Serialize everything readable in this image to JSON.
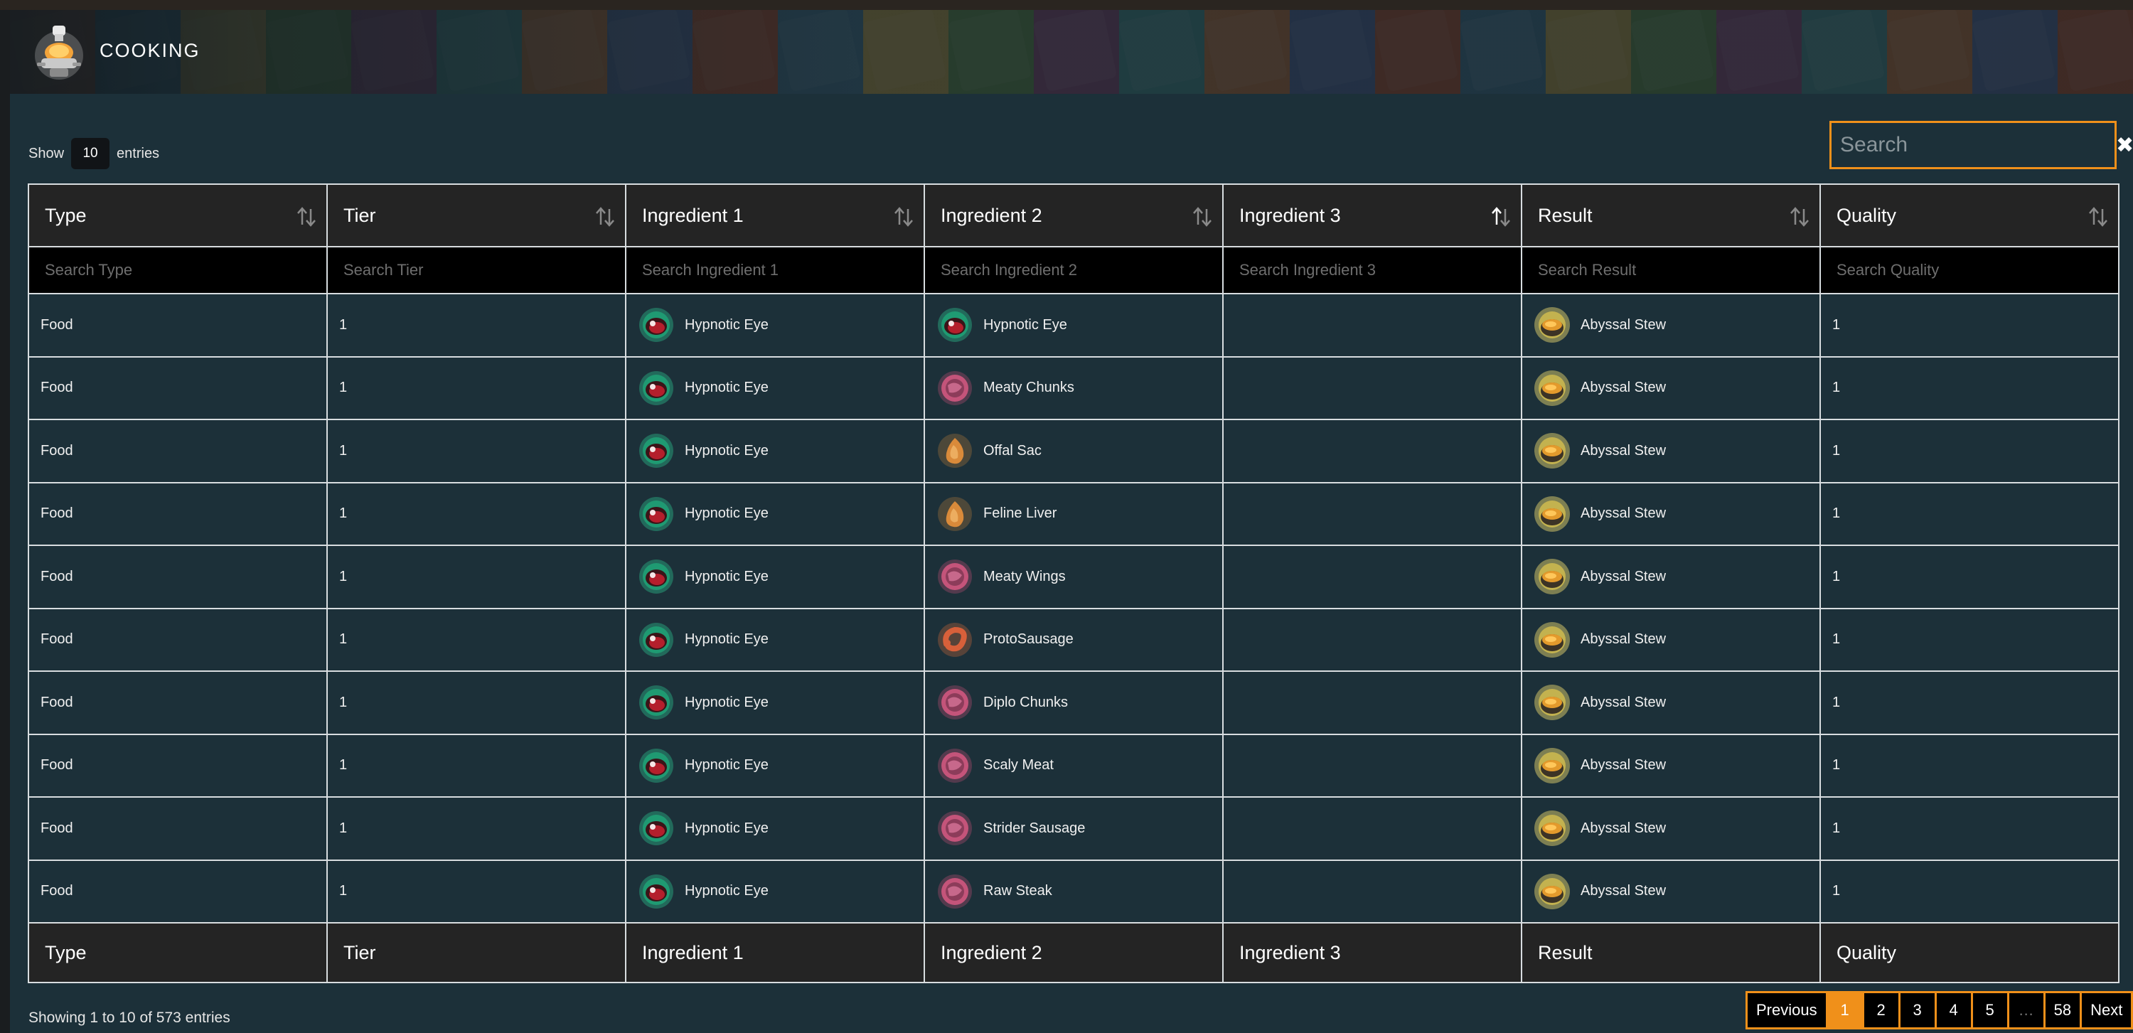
{
  "header": {
    "title": "COOKING",
    "logo_icon": "cooking-chef-icon"
  },
  "controls": {
    "show_label": "Show",
    "entries_value": "10",
    "entries_label": "entries",
    "search_placeholder": "Search",
    "clear_icon": "close-icon"
  },
  "table": {
    "columns": [
      "Type",
      "Tier",
      "Ingredient 1",
      "Ingredient 2",
      "Ingredient 3",
      "Result",
      "Quality"
    ],
    "sorted_column": "Ingredient 3",
    "sorted_direction": "ascending",
    "filter_placeholders": [
      "Search Type",
      "Search Tier",
      "Search Ingredient 1",
      "Search Ingredient 2",
      "Search Ingredient 3",
      "Search Result",
      "Search Quality"
    ],
    "rows": [
      {
        "type": "Food",
        "tier": "1",
        "ing1": "Hypnotic Eye",
        "ing1_icon": "eye",
        "ing2": "Hypnotic Eye",
        "ing2_icon": "eye",
        "ing3": "",
        "result": "Abyssal Stew",
        "quality": "1"
      },
      {
        "type": "Food",
        "tier": "1",
        "ing1": "Hypnotic Eye",
        "ing1_icon": "eye",
        "ing2": "Meaty Chunks",
        "ing2_icon": "meat",
        "ing3": "",
        "result": "Abyssal Stew",
        "quality": "1"
      },
      {
        "type": "Food",
        "tier": "1",
        "ing1": "Hypnotic Eye",
        "ing1_icon": "eye",
        "ing2": "Offal Sac",
        "ing2_icon": "sac",
        "ing3": "",
        "result": "Abyssal Stew",
        "quality": "1"
      },
      {
        "type": "Food",
        "tier": "1",
        "ing1": "Hypnotic Eye",
        "ing1_icon": "eye",
        "ing2": "Feline Liver",
        "ing2_icon": "sac",
        "ing3": "",
        "result": "Abyssal Stew",
        "quality": "1"
      },
      {
        "type": "Food",
        "tier": "1",
        "ing1": "Hypnotic Eye",
        "ing1_icon": "eye",
        "ing2": "Meaty Wings",
        "ing2_icon": "meat",
        "ing3": "",
        "result": "Abyssal Stew",
        "quality": "1"
      },
      {
        "type": "Food",
        "tier": "1",
        "ing1": "Hypnotic Eye",
        "ing1_icon": "eye",
        "ing2": "ProtoSausage",
        "ing2_icon": "sausage",
        "ing3": "",
        "result": "Abyssal Stew",
        "quality": "1"
      },
      {
        "type": "Food",
        "tier": "1",
        "ing1": "Hypnotic Eye",
        "ing1_icon": "eye",
        "ing2": "Diplo Chunks",
        "ing2_icon": "meat",
        "ing3": "",
        "result": "Abyssal Stew",
        "quality": "1"
      },
      {
        "type": "Food",
        "tier": "1",
        "ing1": "Hypnotic Eye",
        "ing1_icon": "eye",
        "ing2": "Scaly Meat",
        "ing2_icon": "meat",
        "ing3": "",
        "result": "Abyssal Stew",
        "quality": "1"
      },
      {
        "type": "Food",
        "tier": "1",
        "ing1": "Hypnotic Eye",
        "ing1_icon": "eye",
        "ing2": "Strider Sausage",
        "ing2_icon": "meat",
        "ing3": "",
        "result": "Abyssal Stew",
        "quality": "1"
      },
      {
        "type": "Food",
        "tier": "1",
        "ing1": "Hypnotic Eye",
        "ing1_icon": "eye",
        "ing2": "Raw Steak",
        "ing2_icon": "meat",
        "ing3": "",
        "result": "Abyssal Stew",
        "quality": "1"
      }
    ]
  },
  "footer": {
    "info": "Showing 1 to 10 of 573 entries",
    "pagination": {
      "previous": "Previous",
      "pages": [
        "1",
        "2",
        "3",
        "4",
        "5",
        "…",
        "58"
      ],
      "active": "1",
      "next": "Next"
    }
  },
  "colors": {
    "accent": "#f0901a",
    "panel_bg": "#1c3039",
    "header_bg": "#242424",
    "filter_bg": "#000000",
    "border": "#d8dde0"
  }
}
